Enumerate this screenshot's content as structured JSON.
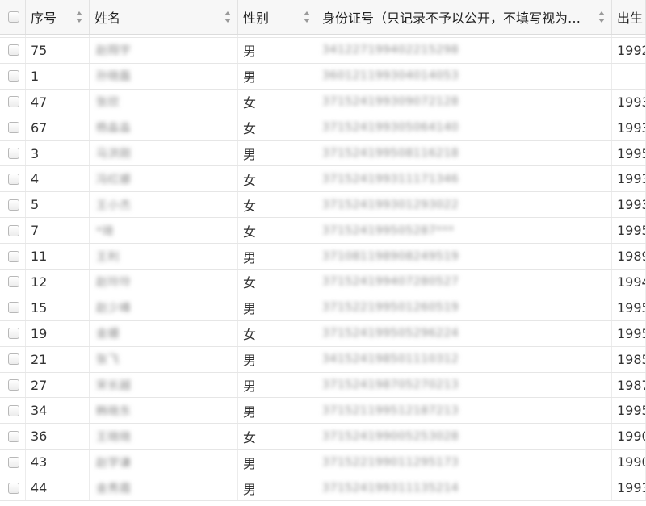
{
  "headers": {
    "seq": "序号",
    "name": "姓名",
    "gender": "性别",
    "idcard": "身份证号（只记录不予以公开，不填写视为…",
    "birth": "出生"
  },
  "rows": [
    {
      "seq": "75",
      "name": "赵翔宇",
      "gender": "男",
      "idcard": "341227199402215298",
      "birth": "1992"
    },
    {
      "seq": "1",
      "name": "孙晓磊",
      "gender": "男",
      "idcard": "360121199304014053",
      "birth": ""
    },
    {
      "seq": "47",
      "name": "张欣",
      "gender": "女",
      "idcard": "371524199309072128",
      "birth": "1993"
    },
    {
      "seq": "67",
      "name": "杨淼淼",
      "gender": "女",
      "idcard": "371524199305064140",
      "birth": "1993"
    },
    {
      "seq": "3",
      "name": "马洪刚",
      "gender": "男",
      "idcard": "371524199508116218",
      "birth": "1995"
    },
    {
      "seq": "4",
      "name": "冯红娜",
      "gender": "女",
      "idcard": "371524199311171346",
      "birth": "1993"
    },
    {
      "seq": "5",
      "name": "王小杰",
      "gender": "女",
      "idcard": "371524199301293022",
      "birth": "1993"
    },
    {
      "seq": "7",
      "name": "*琦",
      "gender": "女",
      "idcard": "371524199505287***",
      "birth": "1995"
    },
    {
      "seq": "11",
      "name": "王利",
      "gender": "男",
      "idcard": "371081198908249519",
      "birth": "1989"
    },
    {
      "seq": "12",
      "name": "赵玲玲",
      "gender": "女",
      "idcard": "371524199407280527",
      "birth": "1994"
    },
    {
      "seq": "15",
      "name": "赵少峰",
      "gender": "男",
      "idcard": "371522199501260519",
      "birth": "1995"
    },
    {
      "seq": "19",
      "name": "金姗",
      "gender": "女",
      "idcard": "371524199505296224",
      "birth": "1995"
    },
    {
      "seq": "21",
      "name": "张飞",
      "gender": "男",
      "idcard": "341524198501110312",
      "birth": "1985"
    },
    {
      "seq": "27",
      "name": "宋长越",
      "gender": "男",
      "idcard": "371524198705270213",
      "birth": "1987"
    },
    {
      "seq": "34",
      "name": "韩晓东",
      "gender": "男",
      "idcard": "371521199512187213",
      "birth": "1995"
    },
    {
      "seq": "36",
      "name": "王晓晓",
      "gender": "女",
      "idcard": "371524199005253028",
      "birth": "1990"
    },
    {
      "seq": "43",
      "name": "赵学谦",
      "gender": "男",
      "idcard": "371522199011295173",
      "birth": "1990"
    },
    {
      "seq": "44",
      "name": "金秀霞",
      "gender": "男",
      "idcard": "371524199311135214",
      "birth": "1993"
    }
  ]
}
